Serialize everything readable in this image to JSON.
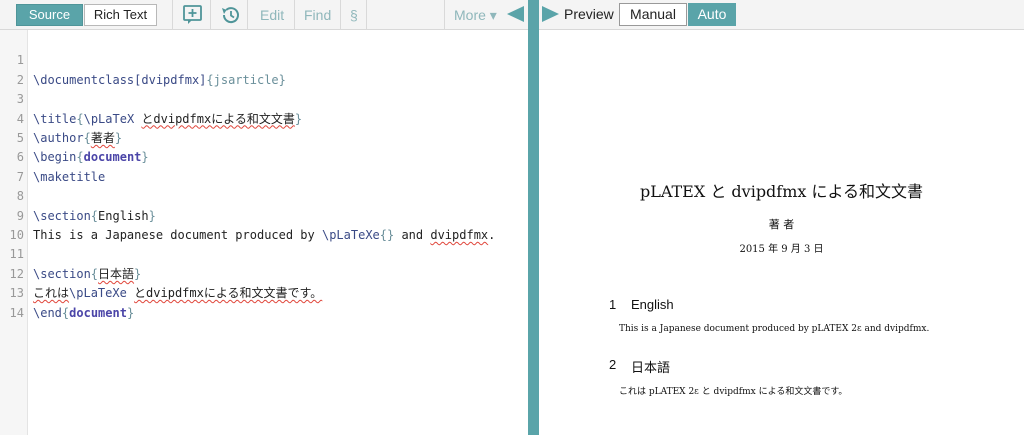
{
  "editor_toolbar": {
    "source_tab": "Source",
    "rich_text_tab": "Rich Text",
    "insert_icon": "add-comment-icon",
    "history_icon": "history-icon",
    "edit_label": "Edit",
    "find_label": "Find",
    "section_label": "§",
    "more_label": "More ▾",
    "collapse_icon": "triangle-left-icon"
  },
  "line_numbers": [
    "1",
    "2",
    "3",
    "4",
    "5",
    "6",
    "7",
    "8",
    "9",
    "10",
    "11",
    "12",
    "13",
    "14"
  ],
  "code": {
    "l1": {
      "cmd": "\\documentclass",
      "opt": "[dvipdfmx]",
      "arg": "{jsarticle}"
    },
    "l3": {
      "cmd": "\\title",
      "open": "{",
      "cmd2": "\\pLaTeX",
      "sp": " ",
      "text": "とdvipdfmxによる和文文書",
      "close": "}"
    },
    "l4": {
      "cmd": "\\author",
      "open": "{",
      "text": "著者",
      "close": "}"
    },
    "l5": {
      "cmd": "\\begin",
      "open": "{",
      "kw": "document",
      "close": "}"
    },
    "l6": {
      "cmd": "\\maketitle"
    },
    "l8": {
      "cmd": "\\section",
      "open": "{",
      "text": "English",
      "close": "}"
    },
    "l9": {
      "pre": "This is a Japanese document produced by ",
      "cmd": "\\pLaTeXe",
      "braces": "{}",
      "mid": " and ",
      "sq": "dvipdfmx",
      "post": "."
    },
    "l11": {
      "cmd": "\\section",
      "open": "{",
      "text": "日本語",
      "close": "}"
    },
    "l12": {
      "pre": "これは",
      "cmd": "\\pLaTeXe",
      "sp": " ",
      "text": "とdvipdfmxによる和文文書です。"
    },
    "l13": {
      "cmd": "\\end",
      "open": "{",
      "kw": "document",
      "close": "}"
    }
  },
  "preview_toolbar": {
    "preview_label": "Preview",
    "manual_tab": "Manual",
    "auto_tab": "Auto",
    "expand_icon": "triangle-right-icon"
  },
  "document": {
    "title": "pLATEX と dvipdfmx による和文文書",
    "author": "著 者",
    "date": "2015 年 9 月 3 日",
    "sections": [
      {
        "number": "1",
        "title": "English",
        "body": "This is a Japanese document produced by pLATEX 2ε and dvipdfmx."
      },
      {
        "number": "2",
        "title": "日本語",
        "body": "これは pLATEX 2ε と dvipdfmx による和文文書です。"
      }
    ]
  },
  "colors": {
    "accent": "#5aa4a9",
    "toolbar_bg": "#f4f4f4",
    "muted_text": "#8fb7bb"
  }
}
